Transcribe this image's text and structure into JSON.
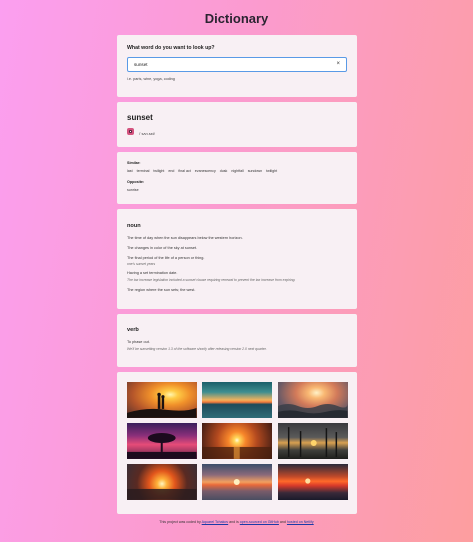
{
  "app": {
    "title": "Dictionary"
  },
  "search": {
    "question": "What word do you want to look up?",
    "value": "sunset",
    "placeholder": "",
    "clear_icon": "×",
    "hint": "i.e. paris, wine, yoga, coding"
  },
  "word": {
    "text": "sunset",
    "phonetic": "/ˈsʌn.sɛt/",
    "audio_icon": "speaker-icon"
  },
  "synonyms": {
    "label": "Similar:",
    "items": [
      "last",
      "terminal",
      "twilight",
      "end",
      "final act",
      "evanescency",
      "dusk",
      "nightfall",
      "sundown",
      "twilight"
    ]
  },
  "antonyms": {
    "label": "Opposite:",
    "items": [
      "sunrise"
    ]
  },
  "noun": {
    "heading": "noun",
    "definitions": [
      {
        "text": "The time of day when the sun disappears below the western horizon."
      },
      {
        "text": "The changes in color of the sky at sunset."
      },
      {
        "text": "The final period of the life of a person or thing.",
        "example": "one's sunset years"
      },
      {
        "text": "Having a set termination date.",
        "example": "The tax increase legislation included a sunset clause requiring renewal to prevent the tax increase from expiring."
      },
      {
        "text": "The region where the sun sets; the west."
      }
    ]
  },
  "verb": {
    "heading": "verb",
    "definitions": [
      {
        "text": "To phase out.",
        "example": "We'll be sunsetting version 1.3 of the software shortly after releasing version 2.0 next quarter."
      }
    ]
  },
  "photos": [
    {
      "alt": "couple silhouette at sunset"
    },
    {
      "alt": "sunset over ocean horizon"
    },
    {
      "alt": "sunset over sea waves"
    },
    {
      "alt": "tree silhouette under purple sky"
    },
    {
      "alt": "orange sun setting over water"
    },
    {
      "alt": "sun setting behind trees"
    },
    {
      "alt": "bright sun over sea at dusk"
    },
    {
      "alt": "sun setting over calm water"
    },
    {
      "alt": "red sunset over the sea"
    }
  ],
  "footer": {
    "prefix": "This project was coded by ",
    "author": "Aquarel Tchakov",
    "middle": " and is ",
    "github": "open-sourced on GitHub",
    "and": " and ",
    "netlify": "hosted on Netlify"
  }
}
